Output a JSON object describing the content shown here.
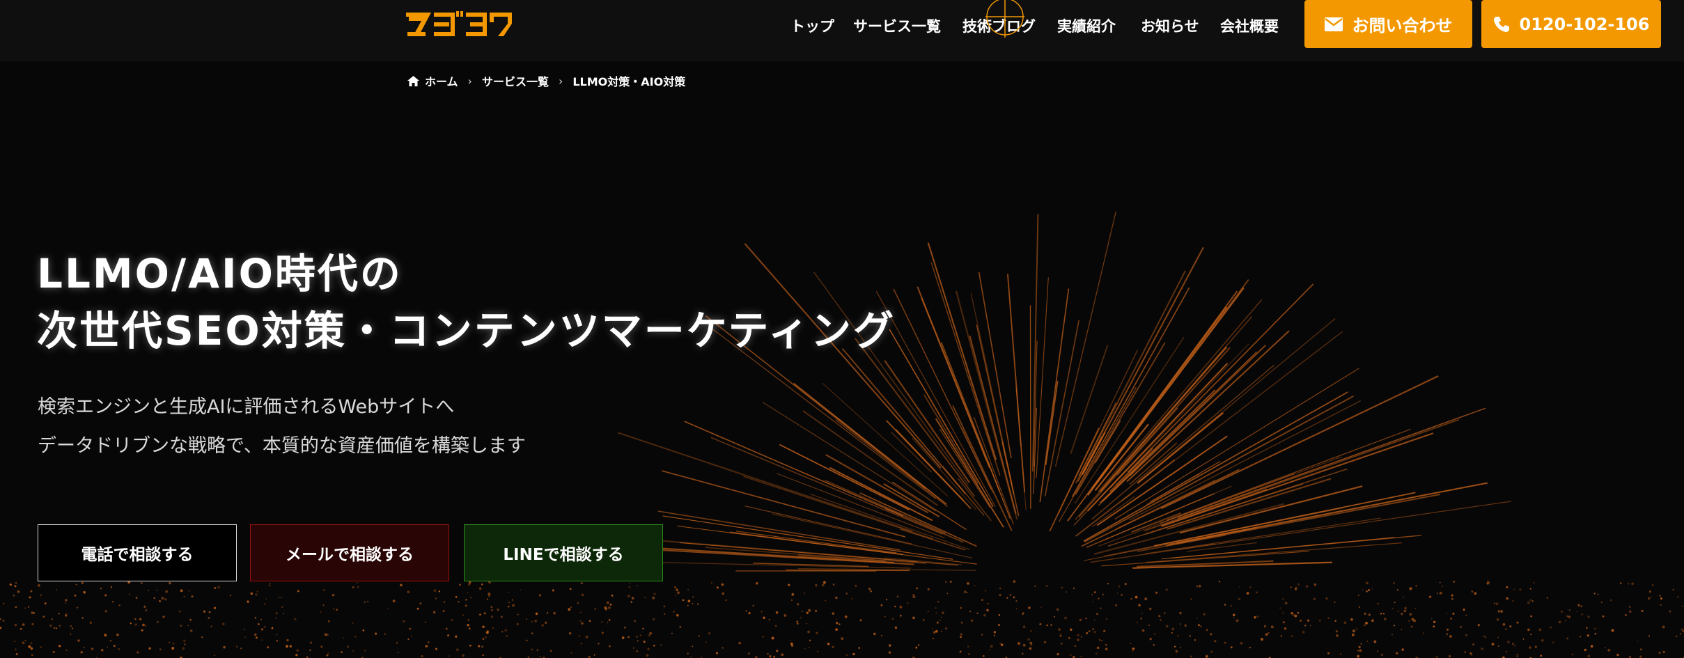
{
  "header": {
    "logo_alt": "ズブラク",
    "nav": [
      {
        "label": "トップ"
      },
      {
        "label": "サービス一覧"
      },
      {
        "label": "技術ブログ"
      },
      {
        "label": "実績紹介"
      },
      {
        "label": "お知らせ"
      },
      {
        "label": "会社概要"
      }
    ],
    "contact_button": "お問い合わせ",
    "phone_button": "0120-102-106"
  },
  "breadcrumb": {
    "home": "ホーム",
    "services": "サービス一覧",
    "current": "LLMO対策・AIO対策"
  },
  "hero": {
    "title_line1": "LLMO/AIO時代の",
    "title_line2": "次世代SEO対策・コンテンツマーケティング",
    "sub_line1": "検索エンジンと生成AIに評価されるWebサイトへ",
    "sub_line2": "データドリブンな戦略で、本質的な資産価値を構築します"
  },
  "cta": {
    "phone": "電話で相談する",
    "mail": "メールで相談する",
    "line": "LINEで相談する"
  },
  "colors": {
    "accent": "#f39800",
    "background": "#070707",
    "header_bg": "#0f0f0f",
    "mail_bg": "#2a0505",
    "line_bg": "#0d2808"
  },
  "icons": {
    "logo": "zubrak-logo",
    "mail": "mail-icon",
    "phone": "phone-icon",
    "home": "home-icon",
    "chevron": "chevron-right-icon",
    "crosshair": "crosshair-icon"
  }
}
